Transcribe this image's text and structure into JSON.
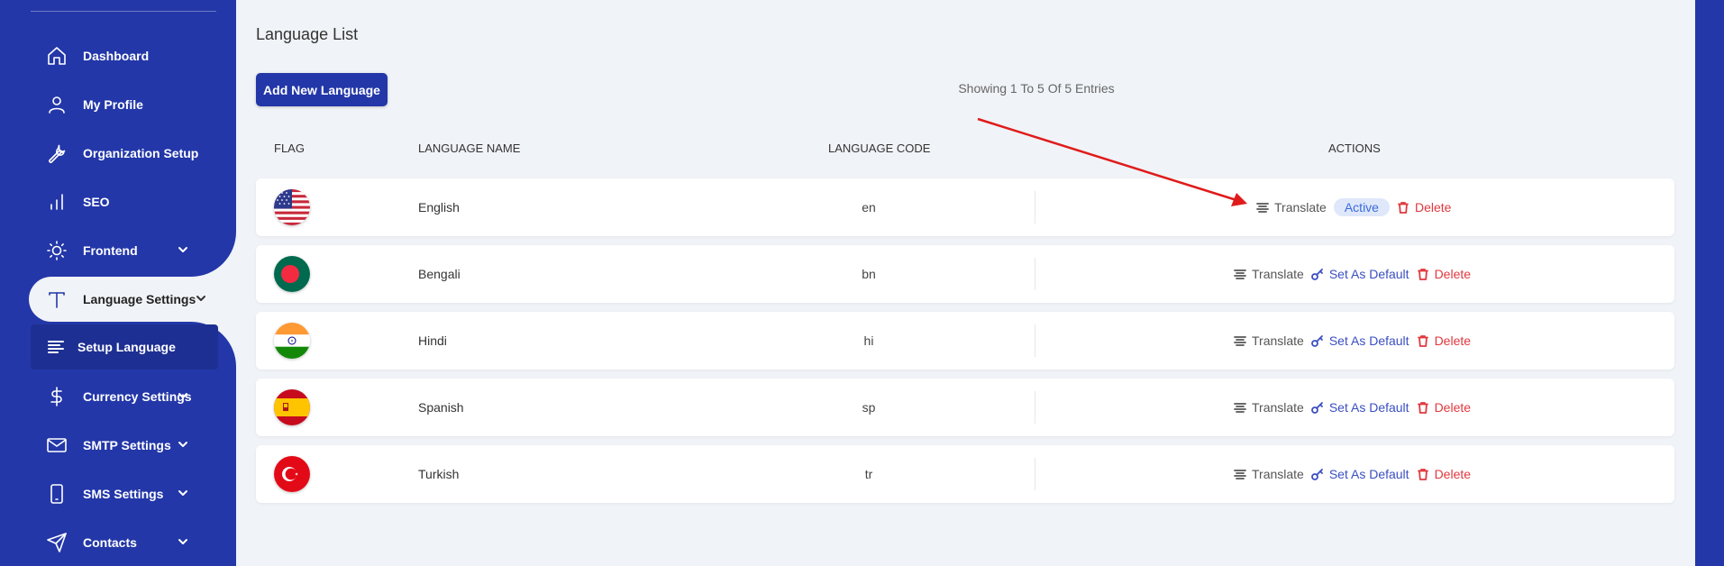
{
  "sidebar": {
    "items": [
      {
        "label": "Dashboard",
        "icon": "home-icon"
      },
      {
        "label": "My Profile",
        "icon": "user-icon"
      },
      {
        "label": "Organization Setup",
        "icon": "wrench-icon"
      },
      {
        "label": "SEO",
        "icon": "bar-chart-icon"
      },
      {
        "label": "Frontend",
        "icon": "sun-icon"
      },
      {
        "label": "Language Settings",
        "icon": "text-t-icon"
      },
      {
        "label": "Setup Language",
        "icon": "lines-icon"
      },
      {
        "label": "Currency Settings",
        "icon": "dollar-icon"
      },
      {
        "label": "SMTP Settings",
        "icon": "mail-icon"
      },
      {
        "label": "SMS Settings",
        "icon": "phone-icon"
      },
      {
        "label": "Contacts",
        "icon": "send-icon"
      }
    ]
  },
  "main": {
    "title": "Language List",
    "add_button": "Add New Language",
    "entries_text": "Showing 1 To 5 Of 5 Entries",
    "columns": [
      "FLAG",
      "LANGUAGE NAME",
      "LANGUAGE CODE",
      "ACTIONS"
    ],
    "rows": [
      {
        "name": "English",
        "code": "en",
        "flag": "us-flag",
        "status": "Active"
      },
      {
        "name": "Bengali",
        "code": "bn",
        "flag": "bangladesh-flag"
      },
      {
        "name": "Hindi",
        "code": "hi",
        "flag": "india-flag"
      },
      {
        "name": "Spanish",
        "code": "sp",
        "flag": "spain-flag"
      },
      {
        "name": "Turkish",
        "code": "tr",
        "flag": "turkey-flag"
      }
    ],
    "actions": {
      "translate": "Translate",
      "set_default": "Set As Default",
      "delete": "Delete"
    }
  },
  "colors": {
    "sidebar": "#2337a8",
    "background": "#f0f3f7",
    "primary": "#3a4fc1",
    "danger": "#e0383e",
    "annotation_arrow": "#e01b1b"
  }
}
